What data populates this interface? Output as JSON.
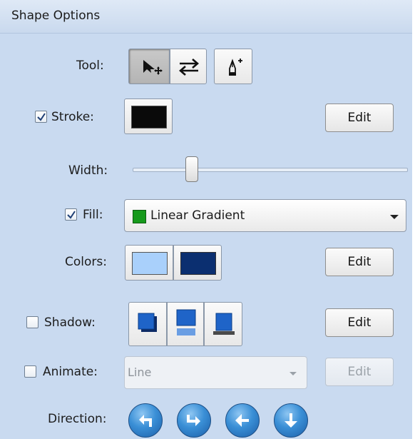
{
  "panel": {
    "title": "Shape Options"
  },
  "tool": {
    "label": "Tool:",
    "buttons": [
      {
        "name": "select-move-icon",
        "selected": true
      },
      {
        "name": "swap-arrows-icon",
        "selected": false
      },
      {
        "name": "pen-add-icon",
        "selected": false
      }
    ]
  },
  "stroke": {
    "label": "Stroke:",
    "checked": true,
    "color": "#0a0a0a",
    "edit_label": "Edit"
  },
  "width": {
    "label": "Width:",
    "slider_value": 0.23
  },
  "fill": {
    "label": "Fill:",
    "checked": true,
    "value": "Linear Gradient",
    "swatch_color": "#169a1c"
  },
  "colors": {
    "label": "Colors:",
    "color1": "#a9d0fb",
    "color2": "#0b2f70",
    "edit_label": "Edit"
  },
  "shadow": {
    "label": "Shadow:",
    "checked": false,
    "edit_label": "Edit"
  },
  "animate": {
    "label": "Animate:",
    "checked": false,
    "value": "Line",
    "edit_label": "Edit"
  },
  "direction": {
    "label": "Direction:",
    "buttons": [
      "turn-up-left-icon",
      "turn-down-right-icon",
      "arrow-left-icon",
      "arrow-down-icon"
    ]
  }
}
